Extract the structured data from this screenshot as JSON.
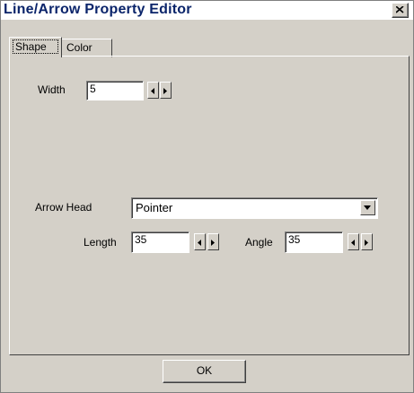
{
  "window": {
    "title": "Line/Arrow Property Editor"
  },
  "tabs": [
    {
      "label": "Shape",
      "active": true
    },
    {
      "label": "Color",
      "active": false
    }
  ],
  "shape": {
    "width_label": "Width",
    "width_value": "5",
    "arrow_head_label": "Arrow Head",
    "arrow_head_value": "Pointer",
    "length_label": "Length",
    "length_value": "35",
    "angle_label": "Angle",
    "angle_value": "35"
  },
  "buttons": {
    "ok_label": "OK"
  },
  "icons": {
    "close": "close-icon",
    "spin_left": "arrow-left-icon",
    "spin_right": "arrow-right-icon",
    "dropdown": "chevron-down-icon"
  },
  "colors": {
    "title_text": "#0a246a",
    "face": "#d4d0c8"
  }
}
